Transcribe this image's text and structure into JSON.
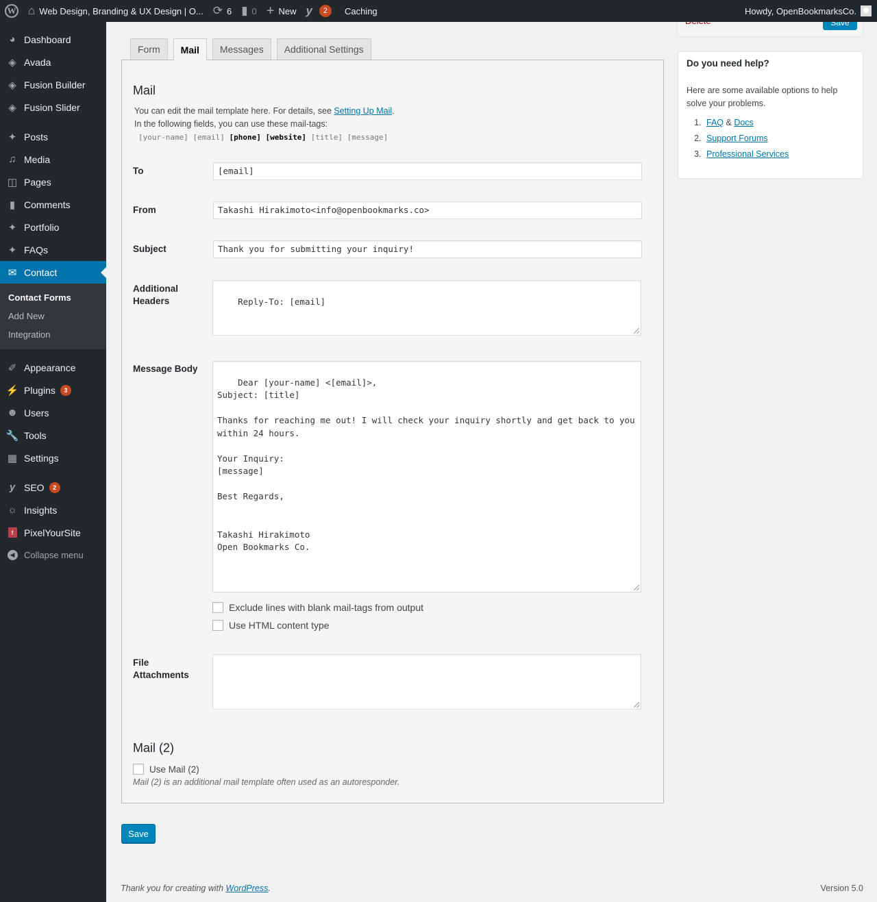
{
  "admin_bar": {
    "site_title": "Web Design, Branding & UX Design | O...",
    "updates_count": "6",
    "comments_count": "0",
    "new_label": "New",
    "yoast_badge": "2",
    "caching_label": "Caching",
    "howdy": "Howdy, OpenBookmarksCo."
  },
  "sidebar": {
    "items": [
      {
        "label": "Dashboard",
        "icon": "dashboard-icon"
      },
      {
        "label": "Avada",
        "icon": "avada-icon"
      },
      {
        "label": "Fusion Builder",
        "icon": "fusion-builder-icon"
      },
      {
        "label": "Fusion Slider",
        "icon": "fusion-slider-icon"
      },
      {
        "label": "Posts",
        "icon": "pin-icon"
      },
      {
        "label": "Media",
        "icon": "media-icon"
      },
      {
        "label": "Pages",
        "icon": "pages-icon"
      },
      {
        "label": "Comments",
        "icon": "comment-icon"
      },
      {
        "label": "Portfolio",
        "icon": "pin-icon"
      },
      {
        "label": "FAQs",
        "icon": "pin-icon"
      },
      {
        "label": "Contact",
        "icon": "envelope-icon"
      },
      {
        "label": "Appearance",
        "icon": "paintbrush-icon"
      },
      {
        "label": "Plugins",
        "icon": "plugin-icon",
        "badge": "3"
      },
      {
        "label": "Users",
        "icon": "user-icon"
      },
      {
        "label": "Tools",
        "icon": "wrench-icon"
      },
      {
        "label": "Settings",
        "icon": "settings-icon"
      },
      {
        "label": "SEO",
        "icon": "yoast-icon",
        "badge": "2"
      },
      {
        "label": "Insights",
        "icon": "insights-icon"
      },
      {
        "label": "PixelYourSite",
        "icon": "pixelyoursite-icon"
      },
      {
        "label": "Collapse menu",
        "icon": "collapse-icon"
      }
    ],
    "submenu": [
      "Contact Forms",
      "Add New",
      "Integration"
    ]
  },
  "tabs": [
    "Form",
    "Mail",
    "Messages",
    "Additional Settings"
  ],
  "active_tab": "Mail",
  "mail": {
    "title": "Mail",
    "desc_1": "You can edit the mail template here. For details, see ",
    "desc_link": "Setting Up Mail",
    "desc_1_end": ".",
    "desc_2": "In the following fields, you can use these mail-tags:",
    "tags": [
      {
        "text": "[your-name]",
        "bold": false
      },
      {
        "text": "[email]",
        "bold": false
      },
      {
        "text": "[phone]",
        "bold": true
      },
      {
        "text": "[website]",
        "bold": true
      },
      {
        "text": "[title]",
        "bold": false
      },
      {
        "text": "[message]",
        "bold": false
      }
    ],
    "fields": {
      "to": {
        "label": "To",
        "value": "[email]"
      },
      "from": {
        "label": "From",
        "value": "Takashi Hirakimoto<info@openbookmarks.co>"
      },
      "subject": {
        "label": "Subject",
        "value": "Thank you for submitting your inquiry!"
      },
      "additional_headers": {
        "label_1": "Additional",
        "label_2": "Headers",
        "value": "Reply-To: [email]"
      },
      "message_body": {
        "label": "Message Body",
        "value": "Dear [your-name] <[email]>,\nSubject: [title]\n\nThanks for reaching me out! I will check your inquiry shortly and get back to you\nwithin 24 hours.\n\nYour Inquiry:\n[message]\n\nBest Regards,\n\n\nTakashi Hirakimoto\nOpen Bookmarks Co."
      },
      "file_attachments": {
        "label_1": "File",
        "label_2": "Attachments",
        "value": ""
      }
    },
    "checkboxes": [
      {
        "label": "Exclude lines with blank mail-tags from output",
        "checked": false
      },
      {
        "label": "Use HTML content type",
        "checked": false
      }
    ]
  },
  "mail2": {
    "title": "Mail (2)",
    "checkbox_label": "Use Mail (2)",
    "checked": false,
    "note": "Mail (2) is an additional mail template often used as an autoresponder."
  },
  "save_label": "Save",
  "publish_box": {
    "delete_label": "Delete",
    "save_label": "Save"
  },
  "help": {
    "title": "Do you need help?",
    "text": "Here are some available options to help solve your problems.",
    "faq": "FAQ",
    "amp": " & ",
    "docs": "Docs",
    "support": "Support Forums",
    "professional": "Professional Services"
  },
  "footer": {
    "thanks": "Thank you for creating with ",
    "wp_link": "WordPress",
    "thanks_end": ".",
    "version": "Version 5.0"
  },
  "colors": {
    "accent": "#0073aa",
    "button": "#0085ba",
    "badge": "#ca4a1f",
    "admin_bg": "#23282d",
    "delete": "#aa0000"
  }
}
